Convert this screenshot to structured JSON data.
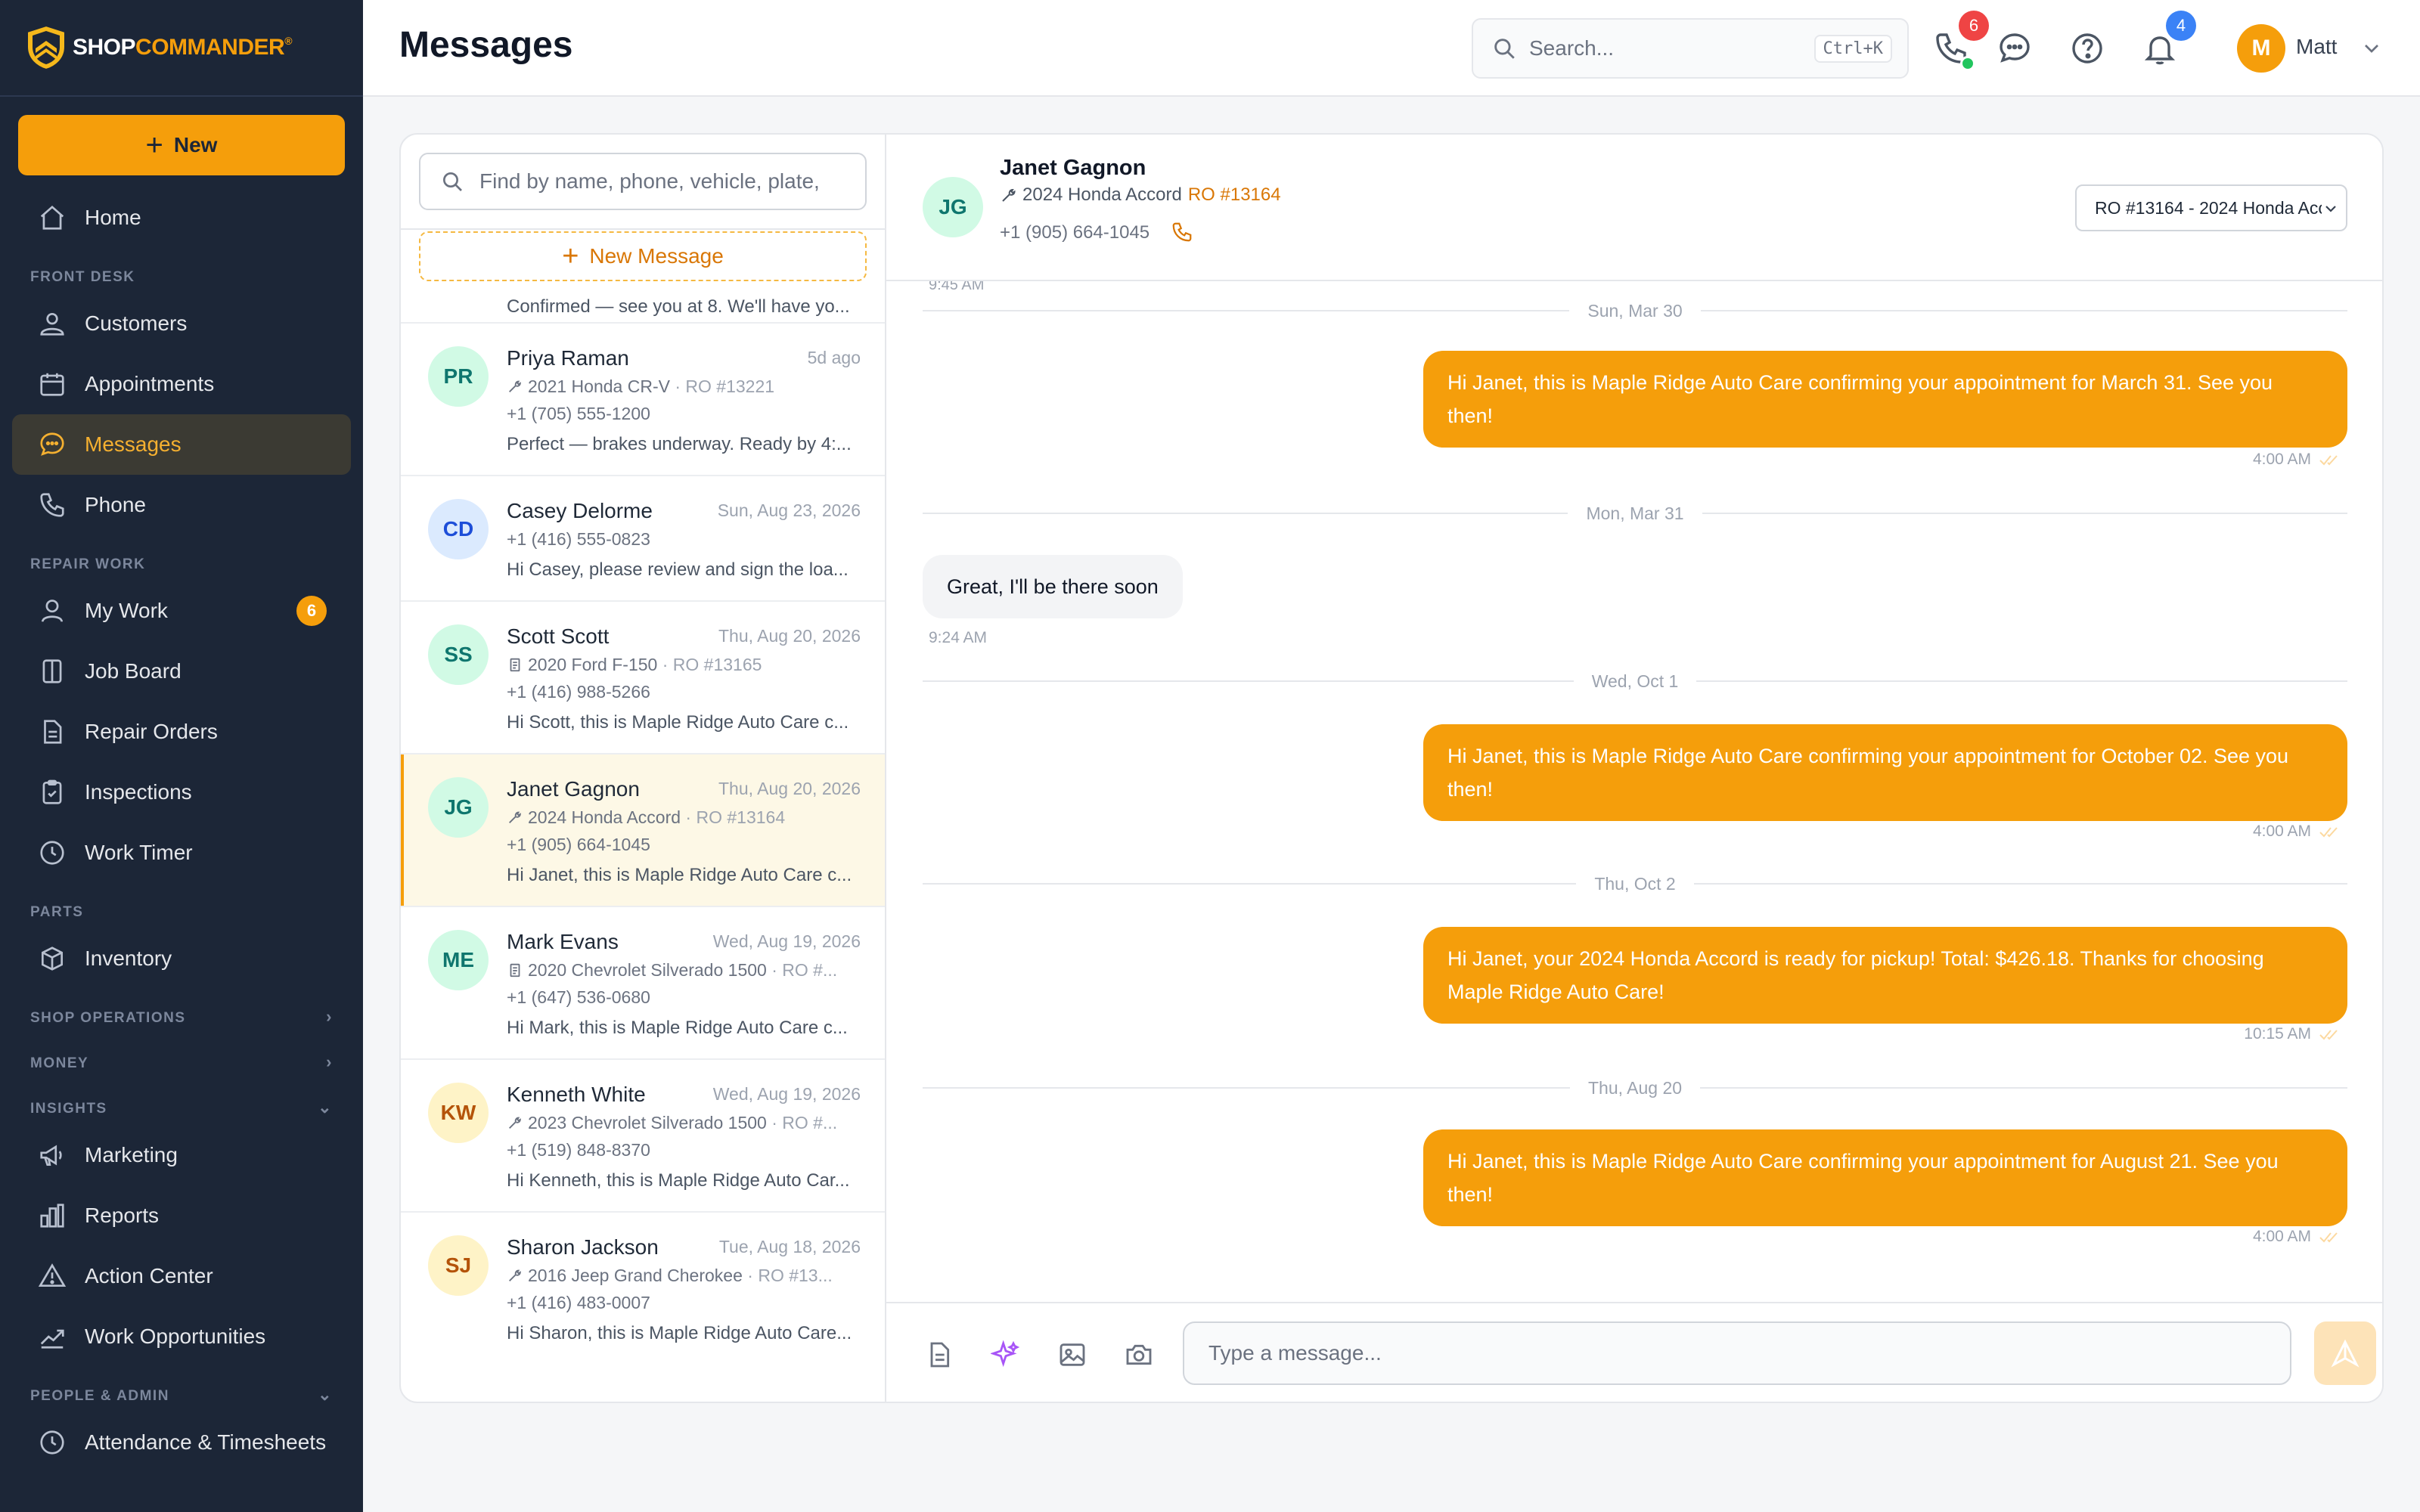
{
  "brand": {
    "name_part1": "SHOP",
    "name_part2": "COMMANDER",
    "reg": "®"
  },
  "sidebar": {
    "new_label": "New",
    "sections": {
      "front_desk": "FRONT DESK",
      "repair_work": "REPAIR WORK",
      "parts": "PARTS",
      "shop_operations": "SHOP OPERATIONS",
      "money": "MONEY",
      "insights": "INSIGHTS",
      "people_admin": "PEOPLE & ADMIN"
    },
    "items": {
      "home": "Home",
      "customers": "Customers",
      "appointments": "Appointments",
      "messages": "Messages",
      "phone": "Phone",
      "my_work": "My Work",
      "my_work_badge": "6",
      "job_board": "Job Board",
      "repair_orders": "Repair Orders",
      "inspections": "Inspections",
      "work_timer": "Work Timer",
      "inventory": "Inventory",
      "marketing": "Marketing",
      "reports": "Reports",
      "action_center": "Action Center",
      "work_opportunities": "Work Opportunities",
      "attendance": "Attendance & Timesheets"
    }
  },
  "header": {
    "title": "Messages",
    "search_placeholder": "Search...",
    "search_shortcut": "Ctrl+K",
    "phone_badge": "6",
    "notifications_badge": "4",
    "user_initial": "M",
    "user_name": "Matt"
  },
  "conversations": {
    "find_placeholder": "Find by name, phone, vehicle, plate,",
    "new_message_label": "New Message",
    "previous_snippet": "Confirmed — see you at 8. We'll have yo...",
    "items": [
      {
        "initials": "PR",
        "name": "Priya Raman",
        "date": "5d ago",
        "vehicle_icon": "wrench-icon",
        "vehicle": "2021 Honda CR-V",
        "ro": "RO #13221",
        "phone": "+1 (705) 555-1200",
        "snippet": "Perfect — brakes underway. Ready by 4:...",
        "avatar_bg": "#d1fae5",
        "avatar_fg": "#0f766e"
      },
      {
        "initials": "CD",
        "name": "Casey Delorme",
        "date": "Sun, Aug 23, 2026",
        "vehicle_icon": "",
        "vehicle": "",
        "ro": "",
        "phone": "+1 (416) 555-0823",
        "snippet": "Hi Casey, please review and sign the loa...",
        "avatar_bg": "#dbeafe",
        "avatar_fg": "#1d4ed8"
      },
      {
        "initials": "SS",
        "name": "Scott Scott",
        "date": "Thu, Aug 20, 2026",
        "vehicle_icon": "clipboard-icon",
        "vehicle": "2020 Ford F-150",
        "ro": "RO #13165",
        "phone": "+1 (416) 988-5266",
        "snippet": "Hi Scott, this is Maple Ridge Auto Care c...",
        "avatar_bg": "#d1fae5",
        "avatar_fg": "#0f766e"
      },
      {
        "initials": "JG",
        "name": "Janet Gagnon",
        "date": "Thu, Aug 20, 2026",
        "vehicle_icon": "wrench-icon",
        "vehicle": "2024 Honda Accord",
        "ro": "RO #13164",
        "phone": "+1 (905) 664-1045",
        "snippet": "Hi Janet, this is Maple Ridge Auto Care c...",
        "avatar_bg": "#d1fae5",
        "avatar_fg": "#0f766e",
        "active": true
      },
      {
        "initials": "ME",
        "name": "Mark Evans",
        "date": "Wed, Aug 19, 2026",
        "vehicle_icon": "clipboard-icon",
        "vehicle": "2020 Chevrolet Silverado 1500",
        "ro": "RO #...",
        "phone": "+1 (647) 536-0680",
        "snippet": "Hi Mark, this is Maple Ridge Auto Care c...",
        "avatar_bg": "#d1fae5",
        "avatar_fg": "#0f766e"
      },
      {
        "initials": "KW",
        "name": "Kenneth White",
        "date": "Wed, Aug 19, 2026",
        "vehicle_icon": "wrench-icon",
        "vehicle": "2023 Chevrolet Silverado 1500",
        "ro": "RO #...",
        "phone": "+1 (519) 848-8370",
        "snippet": "Hi Kenneth, this is Maple Ridge Auto Car...",
        "avatar_bg": "#fef3c7",
        "avatar_fg": "#b45309"
      },
      {
        "initials": "SJ",
        "name": "Sharon Jackson",
        "date": "Tue, Aug 18, 2026",
        "vehicle_icon": "wrench-icon",
        "vehicle": "2016 Jeep Grand Cherokee",
        "ro": "RO #13...",
        "phone": "+1 (416) 483-0007",
        "snippet": "Hi Sharon, this is Maple Ridge Auto Care...",
        "avatar_bg": "#fef3c7",
        "avatar_fg": "#b45309"
      }
    ]
  },
  "chat": {
    "initials": "JG",
    "name": "Janet Gagnon",
    "vehicle": "2024 Honda Accord",
    "ro": "RO #13164",
    "phone": "+1 (905) 664-1045",
    "ro_select": "RO #13164 - 2024 Honda Accord",
    "cut_time": "9:45 AM",
    "messages": [
      {
        "day": "Sun, Mar 30",
        "direction": "out",
        "text": "Hi Janet, this is Maple Ridge Auto Care confirming your appointment for March 31. See you then!",
        "time": "4:00 AM"
      },
      {
        "day": "Mon, Mar 31",
        "direction": "in",
        "text": "Great, I'll be there soon",
        "time": "9:24 AM"
      },
      {
        "day": "Wed, Oct 1",
        "direction": "out",
        "text": "Hi Janet, this is Maple Ridge Auto Care confirming your appointment for October 02. See you then!",
        "time": "4:00 AM"
      },
      {
        "day": "Thu, Oct 2",
        "direction": "out",
        "text": "Hi Janet, your 2024 Honda Accord is ready for pickup! Total: $426.18. Thanks for choosing Maple Ridge Auto Care!",
        "time": "10:15 AM"
      },
      {
        "day": "Thu, Aug 20",
        "direction": "out",
        "text": "Hi Janet, this is Maple Ridge Auto Care confirming your appointment for August 21. See you then!",
        "time": "4:00 AM"
      }
    ],
    "composer_placeholder": "Type a message..."
  },
  "colors": {
    "accent": "#f59e0b",
    "sidebar_bg": "#1c2637",
    "active_nav_bg": "#3b3a33"
  }
}
